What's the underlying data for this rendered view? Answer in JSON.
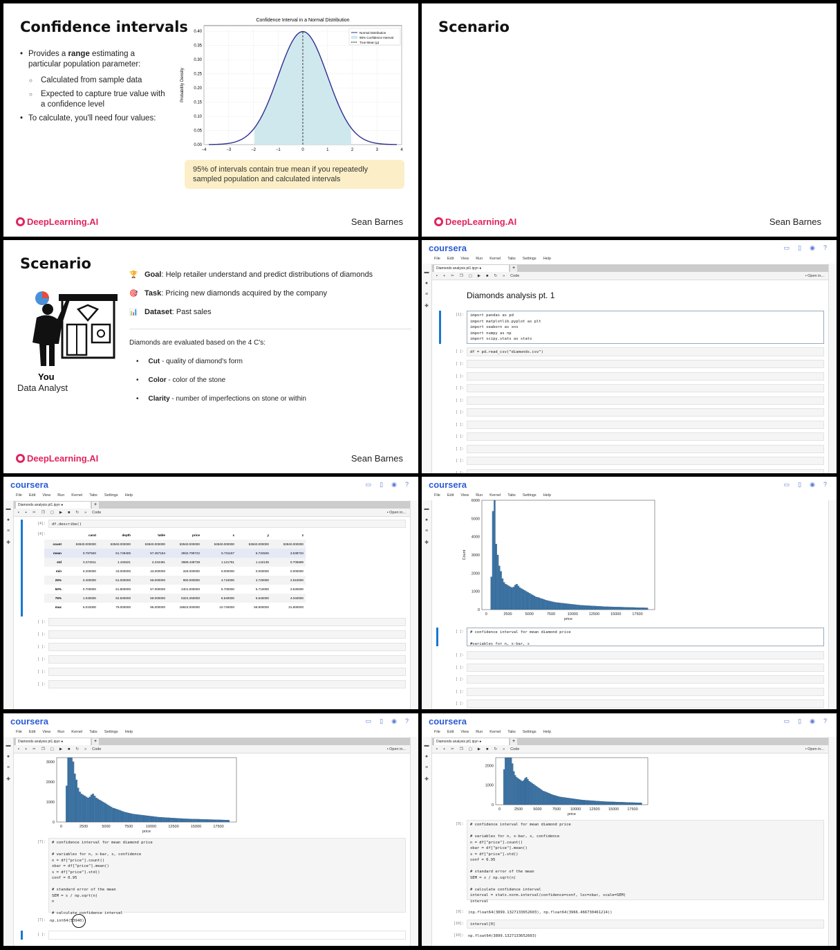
{
  "slide1": {
    "title": "Confidence intervals",
    "bullet1_pre": "Provides a ",
    "bullet1_bold": "range",
    "bullet1_post": " estimating a particular population parameter:",
    "sub1": "Calculated from sample data",
    "sub2": "Expected to capture true value with a confidence level",
    "bullet2": "To calculate, you'll need four values:",
    "callout": "95% of intervals contain true mean if you repeatedly sampled population and calculated intervals",
    "brand": "DeepLearning.AI",
    "author": "Sean Barnes"
  },
  "slide2": {
    "title": "Scenario",
    "brand": "DeepLearning.AI",
    "author": "Sean Barnes"
  },
  "slide3": {
    "title": "Scenario",
    "you": "You",
    "role": "Data Analyst",
    "goal_label": "Goal",
    "goal": ": Help retailer understand and predict distributions of diamonds",
    "task_label": "Task",
    "task": ": Pricing new diamonds acquired by the company",
    "dataset_label": "Dataset",
    "dataset": ": Past sales",
    "intro": "Diamonds are evaluated based on the 4 C's:",
    "c1_label": "Cut",
    "c1": " - quality of diamond's form",
    "c2_label": "Color",
    "c2": "  - color of the stone",
    "c3_label": "Clarity",
    "c3": " - number of imperfections on stone or within",
    "brand": "DeepLearning.AI",
    "author": "Sean Barnes"
  },
  "notebook": {
    "logo": "coursera",
    "menu": [
      "File",
      "Edit",
      "View",
      "Run",
      "Kernel",
      "Tabs",
      "Settings",
      "Help"
    ],
    "tab_name": "Diamonds analysis pt1.ipyn ●",
    "cell_type": "Code",
    "open_in": "• Open in...",
    "md_title": "Diamonds analysis pt. 1",
    "p1": "[1]:",
    "empty_prompt": "[ ]:",
    "p4": "[4]:",
    "p7": "[7]:",
    "p9": "[9]:",
    "p10": "[10]:",
    "cell1": "import pandas as pd\nimport matplotlib.pyplot as plt\nimport seaborn as sns\nimport numpy as np\nimport scipy.stats as stats",
    "cell2": "df = pd.read_csv(\"diamonds.csv\")",
    "cell4": "df.describe()",
    "ci_cell_a": "# confidence interval for mean diamond price\n\n#variables for n, x-bar, s",
    "ci_cell_b": "# confidence interval for mean diamond price\n\n# variables for n, x-bar, s, confidence\nn = df[\"price\"].count()\nxbar = df[\"price\"].mean()\ns = df[\"price\"].std()\nconf = 0.95\n\n# standard error of the mean\nSEM = s / np.sqrt(n)\nn\n\n# calculate confidence interval",
    "out7": "np.int64(53940)",
    "ci_cell_c": "# confidence interval for mean diamond price\n\n# variables for n, x-bar, s, confidence\nn = df[\"price\"].count()\nxbar = df[\"price\"].mean()\ns = df[\"price\"].std()\nconf = 0.95\n\n# standard error of the mean\nSEM = s / np.sqrt(n)\n\n# calculate confidence interval\ninterval = stats.norm.interval(confidence=conf, loc=xbar, scale=SEM)\ninterval",
    "out9": "(np.float64(3899.1327133652603), np.float64(3966.466730461214))",
    "cell10": "interval[0]",
    "out10": "np.float64(3899.1327133652603)"
  },
  "describe": {
    "columns": [
      "",
      "carat",
      "depth",
      "table",
      "price",
      "x",
      "y",
      "z"
    ],
    "rows": [
      [
        "count",
        "53940.000000",
        "53940.000000",
        "53940.000000",
        "53940.000000",
        "53940.000000",
        "53940.000000",
        "53940.000000"
      ],
      [
        "mean",
        "0.797940",
        "61.749405",
        "57.457184",
        "3932.799722",
        "5.731157",
        "5.734526",
        "3.538734"
      ],
      [
        "std",
        "0.474011",
        "1.432621",
        "2.234491",
        "3989.439738",
        "1.121761",
        "1.142135",
        "0.705699"
      ],
      [
        "min",
        "0.200000",
        "43.000000",
        "43.000000",
        "326.000000",
        "0.000000",
        "0.000000",
        "0.000000"
      ],
      [
        "25%",
        "0.400000",
        "61.000000",
        "56.000000",
        "950.000000",
        "4.710000",
        "4.720000",
        "2.910000"
      ],
      [
        "50%",
        "0.700000",
        "61.800000",
        "57.000000",
        "2401.000000",
        "5.700000",
        "5.710000",
        "3.530000"
      ],
      [
        "75%",
        "1.040000",
        "62.500000",
        "59.000000",
        "5324.250000",
        "6.540000",
        "6.540000",
        "4.040000"
      ],
      [
        "max",
        "5.010000",
        "79.000000",
        "95.000000",
        "18823.000000",
        "10.740000",
        "58.900000",
        "31.800000"
      ]
    ]
  },
  "chart_data": [
    {
      "type": "line",
      "title": "Confidence Interval in a Normal Distribution",
      "xlabel": "",
      "ylabel": "Probability Density",
      "xlim": [
        -4,
        4
      ],
      "ylim": [
        0,
        0.42
      ],
      "xticks": [
        "-4",
        "-3",
        "-2",
        "-1",
        "0",
        "1",
        "2",
        "3",
        "4"
      ],
      "yticks": [
        "0.00",
        "0.05",
        "0.10",
        "0.15",
        "0.20",
        "0.25",
        "0.30",
        "0.35",
        "0.40"
      ],
      "legend": [
        "Normal Distribution",
        "95% Confidence Interval",
        "True Mean (μ)"
      ],
      "legend_position": "top-right",
      "shaded_interval": [
        -1.96,
        1.96
      ],
      "mean": 0,
      "line_color": "#2b2f8f",
      "fill_color": "#cfe8ee"
    },
    {
      "type": "bar",
      "title": "",
      "xlabel": "price",
      "ylabel": "Count",
      "xticks": [
        "0",
        "2500",
        "5000",
        "7500",
        "10000",
        "12500",
        "15000",
        "17500"
      ],
      "yticks": [
        "0",
        "1000",
        "2000",
        "3000",
        "4000",
        "5000",
        "6000"
      ],
      "xlim": [
        -500,
        19500
      ],
      "ylim": [
        0,
        6000
      ],
      "bar_color": "#3d76a8",
      "bin_width": 184,
      "values": [
        0,
        1800,
        5400,
        6000,
        3600,
        3000,
        2400,
        2100,
        1700,
        1500,
        1400,
        1350,
        1300,
        1250,
        1200,
        1250,
        1350,
        1400,
        1300,
        1200,
        1150,
        1100,
        1050,
        1000,
        950,
        900,
        850,
        800,
        750,
        700,
        680,
        650,
        620,
        590,
        560,
        530,
        500,
        480,
        460,
        440,
        420,
        400,
        390,
        380,
        370,
        360,
        350,
        340,
        330,
        320,
        310,
        300,
        290,
        280,
        270,
        260,
        250,
        240,
        235,
        230,
        225,
        220,
        215,
        210,
        205,
        200,
        195,
        190,
        185,
        180,
        175,
        170,
        165,
        160,
        158,
        155,
        152,
        150,
        148,
        145,
        142,
        140,
        138,
        135,
        132,
        130,
        128,
        125,
        122,
        120,
        118,
        115,
        112,
        110,
        108,
        105,
        102,
        100,
        98,
        95
      ]
    }
  ]
}
